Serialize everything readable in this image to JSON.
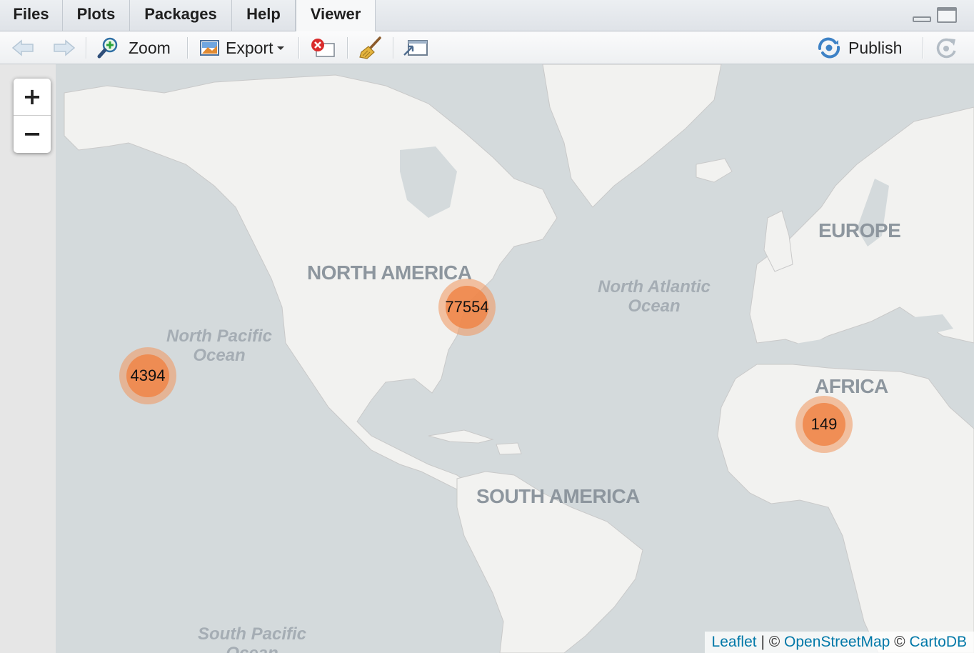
{
  "tabs": [
    {
      "label": "Files"
    },
    {
      "label": "Plots"
    },
    {
      "label": "Packages"
    },
    {
      "label": "Help"
    },
    {
      "label": "Viewer"
    }
  ],
  "active_tab": "Viewer",
  "toolbar": {
    "zoom_label": "Zoom",
    "export_label": "Export",
    "publish_label": "Publish",
    "icons": [
      "back-arrow-icon",
      "forward-arrow-icon",
      "zoom-icon",
      "export-icon",
      "remove-viewer-icon",
      "clear-broom-icon",
      "popout-icon",
      "publish-icon",
      "refresh-icon"
    ]
  },
  "map": {
    "zoom_in": "+",
    "zoom_out": "−",
    "clusters": [
      {
        "count": "4394"
      },
      {
        "count": "77554"
      },
      {
        "count": "149"
      }
    ],
    "labels": {
      "north_america": "NORTH AMERICA",
      "south_america": "SOUTH AMERICA",
      "europe": "EUROPE",
      "africa": "AFRICA",
      "north_pacific_1": "North Pacific",
      "north_pacific_2": "Ocean",
      "north_atlantic_1": "North Atlantic",
      "north_atlantic_2": "Ocean",
      "south_pacific_1": "South Pacific",
      "south_pacific_2": "Ocean"
    },
    "attribution": {
      "leaflet": "Leaflet",
      "sep1": " | © ",
      "osm": "OpenStreetMap",
      "sep2": " © ",
      "carto": "CartoDB"
    },
    "colors": {
      "water": "#d4dadc",
      "land": "#f2f2f0",
      "cluster_outer": "#f1965c",
      "cluster_inner": "#f08548",
      "link": "#0078a8"
    }
  }
}
